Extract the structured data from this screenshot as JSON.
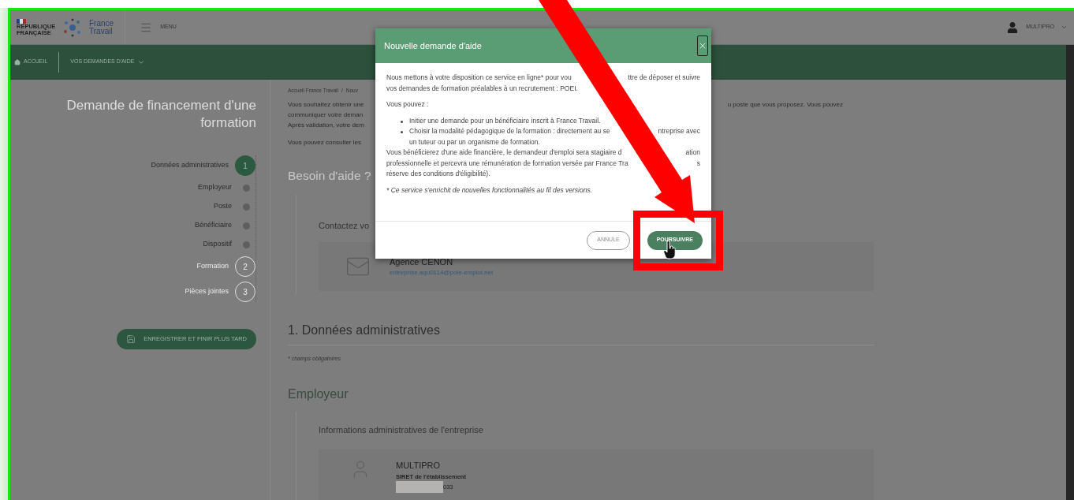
{
  "header": {
    "republic": "RÉPUBLIQUE FRANÇAISE",
    "brand": [
      "France",
      "Travail"
    ],
    "menu": "MENU",
    "user": "MULTIPRO"
  },
  "nav": [
    {
      "kind": "home",
      "label": "ACCUEIL"
    },
    {
      "kind": "dropdown",
      "label": "VOS DEMANDES D'AIDE"
    }
  ],
  "sidebar": {
    "title": "Demande de financement d'une formation",
    "steps": [
      {
        "kind": "step",
        "label": "Données administratives",
        "number": "1",
        "selected": true
      },
      {
        "kind": "substep",
        "label": "Employeur"
      },
      {
        "kind": "substep",
        "label": "Poste"
      },
      {
        "kind": "substep",
        "label": "Bénéficiaire"
      },
      {
        "kind": "substep",
        "label": "Dispositif"
      },
      {
        "kind": "step",
        "label": "Formation",
        "number": "2",
        "selected": false
      },
      {
        "kind": "step",
        "label": "Pièces jointes",
        "number": "3",
        "selected": false
      }
    ],
    "save_button": "ENREGISTRER ET FINIR PLUS TARD"
  },
  "main": {
    "breadcrumb": [
      "Accueil France Travail",
      "/",
      "Nouv"
    ],
    "intro": [
      [
        "Vous souhaitez obtenir une",
        "u poste que vous proposez. Vous pouvez"
      ],
      [
        "communiquer votre deman"
      ],
      [
        "Après validation, votre dem"
      ]
    ],
    "consult": "Vous pouvez consulter les",
    "help_title": "Besoin d'aide ?",
    "contact_label": "Contactez vo",
    "agency": {
      "name": "Agence CENON",
      "email": "entreprise.aqu0114@pole-emploi.net"
    },
    "section_title": "1. Données administratives",
    "required_note": "* champs obligatoires",
    "employer_title": "Employeur",
    "company_label": "Informations administratives de l'entreprise",
    "company": {
      "name": "MULTIPRO",
      "siret_label": "SIRET de l'établissement",
      "siret_tail": "033"
    }
  },
  "dialog": {
    "title": "Nouvelle demande d'aide",
    "body": [
      {
        "kind": "paragraph",
        "lines": [
          [
            "Nous mettons à votre disposition ce service en ligne* pour vou",
            "ttre de déposer et suivre"
          ],
          [
            "vos demandes de formation préalables à un recrutement : POEI."
          ]
        ]
      },
      {
        "kind": "paragraph",
        "lines": [
          [
            "Vous pouvez :"
          ]
        ]
      },
      {
        "kind": "bullet",
        "lines": [
          [
            "Initier une demande pour un bénéficiaire inscrit à France Travail."
          ]
        ]
      },
      {
        "kind": "bullet",
        "lines": [
          [
            "Choisir la modalité pédagogique de la formation : directement au se",
            "ntreprise avec"
          ],
          [
            "un tuteur ou par un organisme de formation."
          ]
        ]
      },
      {
        "kind": "paragraph",
        "lines": [
          [
            "Vous bénéficierez d'une aide financière, le demandeur d'emploi sera stagiaire d",
            "ation"
          ],
          [
            "professionnelle et percevra une rémunération de formation versée par France Tra",
            "s"
          ],
          [
            "réserve des conditions d'éligibilité)."
          ]
        ]
      },
      {
        "kind": "note",
        "lines": [
          [
            "* Ce service s'enrichit de nouvelles fonctionnalités au fil des versions."
          ]
        ]
      }
    ],
    "buttons": [
      {
        "kind": "secondary",
        "label": "ANNULE"
      },
      {
        "kind": "primary",
        "label": "POURSUIVRE"
      }
    ]
  }
}
